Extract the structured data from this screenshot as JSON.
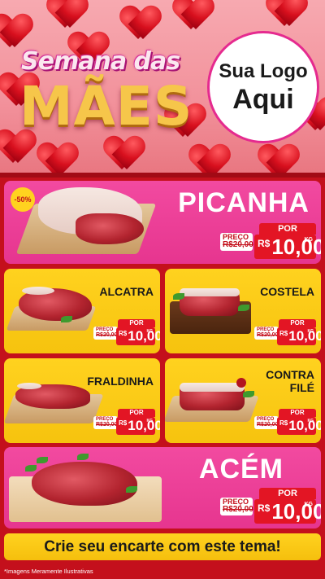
{
  "header": {
    "title_top": "Semana das",
    "title_main": "MÃES",
    "logo_line1": "Sua Logo",
    "logo_line2": "Aqui"
  },
  "colors": {
    "background": "#c4101c",
    "pink_card": "#e6358f",
    "yellow_card": "#f6c30e",
    "price_red": "#e31524"
  },
  "products": {
    "picanha": {
      "name": "PICANHA",
      "badge": "-50%",
      "preco_label": "PREÇO",
      "old_price": "R$20,00",
      "por_label": "POR",
      "currency": "R$",
      "price": "10,00",
      "unit": "KG"
    },
    "alcatra": {
      "name": "ALCATRA",
      "preco_label": "PREÇO",
      "old_price": "R$20,00",
      "por_label": "POR",
      "currency": "R$",
      "price": "10,00",
      "unit": "KG"
    },
    "costela": {
      "name": "COSTELA",
      "preco_label": "PREÇO",
      "old_price": "R$20,00",
      "por_label": "POR",
      "currency": "R$",
      "price": "10,00",
      "unit": "KG"
    },
    "fraldinha": {
      "name": "FRALDINHA",
      "preco_label": "PREÇO",
      "old_price": "R$20,00",
      "por_label": "POR",
      "currency": "R$",
      "price": "10,00",
      "unit": "KG"
    },
    "contrafile": {
      "name_line1": "CONTRA",
      "name_line2": "FILÉ",
      "preco_label": "PREÇO",
      "old_price": "R$20,00",
      "por_label": "POR",
      "currency": "R$",
      "price": "10,00",
      "unit": "KG"
    },
    "acem": {
      "name": "ACÉM",
      "preco_label": "PREÇO",
      "old_price": "R$20,00",
      "por_label": "POR",
      "currency": "R$",
      "price": "10,00",
      "unit": "KG"
    }
  },
  "footer": {
    "cta": "Crie seu encarte com este tema!",
    "disclaimer": "*Imagens Meramente Ilustrativas"
  }
}
